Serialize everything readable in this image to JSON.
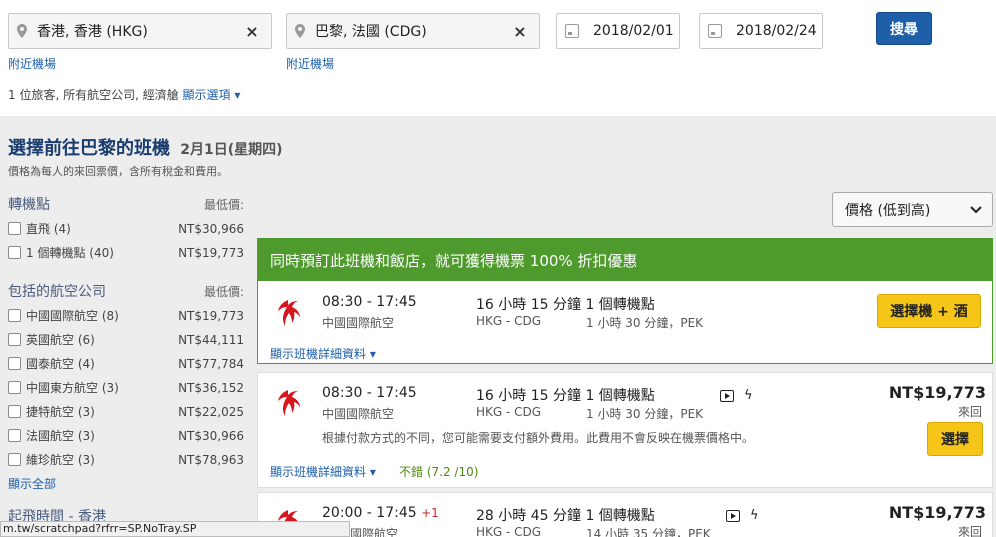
{
  "search": {
    "origin": "香港, 香港 (HKG)",
    "destination": "巴黎, 法國 (CDG)",
    "depart_date": "2018/02/01",
    "return_date": "2018/02/24",
    "search_label": "搜尋",
    "nearby_origin": "附近機場",
    "nearby_destination": "附近機場",
    "summary": "1 位旅客, 所有航空公司, 經濟艙",
    "options_label": "顯示選項 ▾"
  },
  "heading": {
    "title": "選擇前往巴黎的班機",
    "date": "2月1日(星期四)",
    "price_note": "價格為每人的來回票價，含所有稅金和費用。"
  },
  "filters": {
    "stops_title": "轉機點",
    "stops_min_label": "最低價:",
    "stops": [
      {
        "label": "直飛 (4)",
        "price": "NT$30,966"
      },
      {
        "label": "1 個轉機點 (40)",
        "price": "NT$19,773"
      }
    ],
    "airlines_title": "包括的航空公司",
    "airlines_min_label": "最低價:",
    "airlines": [
      {
        "label": "中國國際航空 (8)",
        "price": "NT$19,773"
      },
      {
        "label": "英國航空 (6)",
        "price": "NT$44,111"
      },
      {
        "label": "國泰航空 (4)",
        "price": "NT$77,784"
      },
      {
        "label": "中國東方航空 (3)",
        "price": "NT$36,152"
      },
      {
        "label": "捷特航空 (3)",
        "price": "NT$22,025"
      },
      {
        "label": "法國航空 (3)",
        "price": "NT$30,966"
      },
      {
        "label": "維珍航空 (3)",
        "price": "NT$78,963"
      }
    ],
    "show_all": "顯示全部",
    "depart_time_title": "起飛時間 - 香港"
  },
  "sort": {
    "label": "價格 (低到高)"
  },
  "promo": {
    "banner": "同時預訂此班機和飯店，就可獲得機票 100% 折扣優惠",
    "times": "08:30 - 17:45",
    "airline": "中國國際航空",
    "duration": "16 小時 15 分鐘",
    "stops": "1 個轉機點",
    "route": "HKG - CDG",
    "layover": "1 小時 30 分鐘，PEK",
    "button": "選擇機 + 酒",
    "details": "顯示班機詳細資料 ▾"
  },
  "flights": [
    {
      "times": "08:30 - 17:45",
      "plus_day": "",
      "airline": "中國國際航空",
      "duration": "16 小時 15 分鐘",
      "stops": "1 個轉機點",
      "route": "HKG - CDG",
      "layover": "1 小時 30 分鐘，PEK",
      "price": "NT$19,773",
      "trip_type": "來回",
      "note": "根據付款方式的不同，您可能需要支付額外費用。此費用不會反映在機票價格中。",
      "button": "選擇",
      "details": "顯示班機詳細資料 ▾",
      "rating": "不錯 (7.2 /10)"
    },
    {
      "times": "20:00 - 17:45",
      "plus_day": "+1",
      "airline": "國際航空",
      "duration": "28 小時 45 分鐘",
      "stops": "1 個轉機點",
      "route": "HKG - CDG",
      "layover": "14 小時 35 分鐘，PEK",
      "price": "NT$19,773",
      "trip_type": "來回"
    }
  ],
  "statusbar": {
    "url": "m.tw/scratchpad?rfrr=SP.NoTray.SP"
  },
  "colors": {
    "brand_blue": "#1f5fa9",
    "promo_green": "#4f9a2d",
    "button_yellow": "#f5c518",
    "air_china_red": "#d7161e"
  }
}
